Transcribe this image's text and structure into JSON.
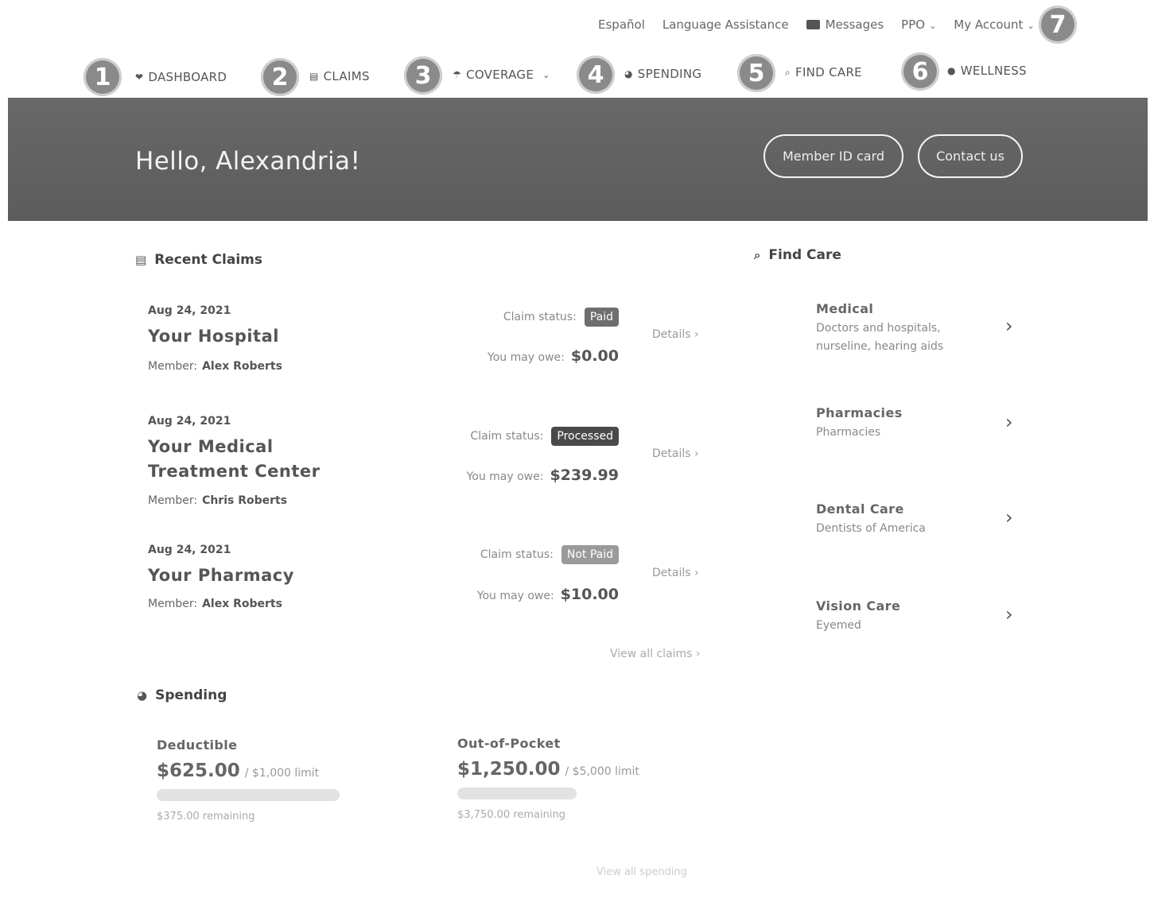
{
  "utility": {
    "espanol": "Español",
    "language": "Language Assistance",
    "messages": "Messages",
    "plan": "PPO",
    "account": "My Account"
  },
  "badges": [
    "1",
    "2",
    "3",
    "4",
    "5",
    "6",
    "7"
  ],
  "nav": {
    "dashboard": "DASHBOARD",
    "claims": "CLAIMS",
    "coverage": "COVERAGE",
    "spending": "SPENDING",
    "find_care": "FIND CARE",
    "wellness": "WELLNESS"
  },
  "banner": {
    "greeting": "Hello, Alexandria!",
    "member_id": "Member ID card",
    "contact": "Contact us"
  },
  "recent_claims": {
    "title": "Recent Claims",
    "status_label": "Claim status:",
    "owe_label": "You may owe:",
    "member_label": "Member:",
    "details": "Details",
    "view_all": "View all claims",
    "items": [
      {
        "date": "Aug 24, 2021",
        "name": "Your Hospital",
        "member": "Alex Roberts",
        "status": "Paid",
        "owe": "$0.00"
      },
      {
        "date": "Aug 24, 2021",
        "name": "Your Medical Treatment Center",
        "member": "Chris Roberts",
        "status": "Processed",
        "owe": "$239.99"
      },
      {
        "date": "Aug 24, 2021",
        "name": "Your Pharmacy",
        "member": "Alex Roberts",
        "status": "Not Paid",
        "owe": "$10.00"
      }
    ]
  },
  "find_care": {
    "title": "Find Care",
    "items": [
      {
        "title": "Medical",
        "desc": "Doctors and hospitals, nurseline, hearing aids"
      },
      {
        "title": "Pharmacies",
        "desc": "Pharmacies"
      },
      {
        "title": "Dental Care",
        "desc": "Dentists of America"
      },
      {
        "title": "Vision Care",
        "desc": "Eyemed"
      }
    ]
  },
  "spending": {
    "title": "Spending",
    "deductible": {
      "label": "Deductible",
      "amount": "$625.00",
      "limit": "/ $1,000 limit",
      "remaining": "$375.00 remaining",
      "progress": 0.625
    },
    "oop": {
      "label": "Out-of-Pocket",
      "amount": "$1,250.00",
      "limit": "/ $5,000 limit",
      "remaining": "$3,750.00 remaining",
      "progress": 0.25
    },
    "view_all": "View all spending"
  },
  "colors": {
    "banner": "#626262",
    "badge": "#8a8a8a",
    "status_paid": "#6e6e6e",
    "status_processed": "#4a4a4a",
    "status_not_paid": "#9a9a9a"
  }
}
